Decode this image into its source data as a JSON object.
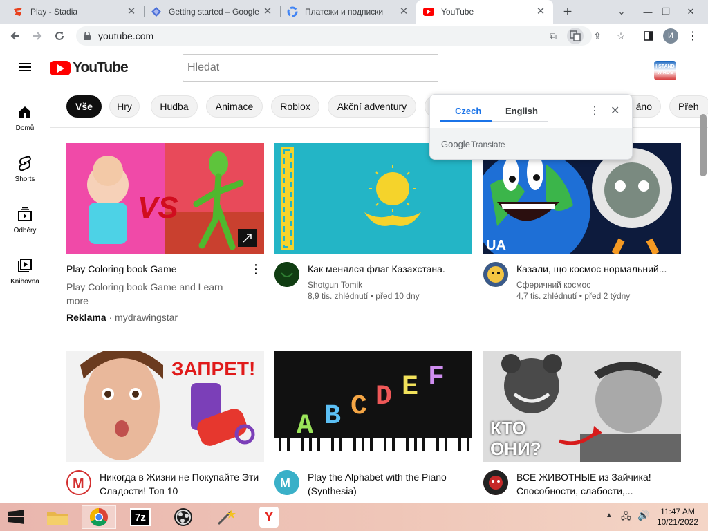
{
  "browser": {
    "tabs": [
      {
        "title": "Play - Stadia",
        "icon": "stadia-icon"
      },
      {
        "title": "Getting started – Google",
        "icon": "gcp-icon"
      },
      {
        "title": "Платежи и подписки",
        "icon": "google-icon"
      },
      {
        "title": "YouTube",
        "icon": "youtube-icon",
        "active": true
      }
    ],
    "url": "youtube.com",
    "profile_initial": "И"
  },
  "youtube": {
    "logo": "YouTube",
    "search_placeholder": "Hledat",
    "badge": "I STAND W RUS",
    "sidebar": [
      {
        "label": "Domů",
        "icon": "home-icon"
      },
      {
        "label": "Shorts",
        "icon": "shorts-icon"
      },
      {
        "label": "Odběry",
        "icon": "subscriptions-icon"
      },
      {
        "label": "Knihovna",
        "icon": "library-icon"
      }
    ],
    "chips": [
      "Vše",
      "Hry",
      "Hudba",
      "Animace",
      "Roblox",
      "Akční adventury",
      "",
      "",
      "áno",
      "Přeh"
    ],
    "videos": [
      {
        "title": "Play Coloring book Game",
        "desc": "Play Coloring book Game and Learn more",
        "ad_label": "Reklama",
        "ad_channel": "· mydrawingstar"
      },
      {
        "title": "Как менялся флаг Казахстана.",
        "channel": "Shotgun Tomik",
        "views": "8,9 tis. zhlédnutí",
        "age": "před 10 dny"
      },
      {
        "title": "Казали, що космос нормальний...",
        "channel": "Сферичний космос",
        "views": "4,7 tis. zhlédnutí",
        "age": "před 2 týdny"
      },
      {
        "title": "Никогда в Жизни не Покупайте Эти Сладости! Топ 10",
        "thumb_text": "ЗАПРЕТ!"
      },
      {
        "title": "Play the Alphabet with the Piano (Synthesia)"
      },
      {
        "title": "ВСЕ ЖИВОТНЫЕ из Зайчика! Способности, слабости,...",
        "thumb_text": "КТО ОНИ?"
      }
    ]
  },
  "translate": {
    "tab_source": "Czech",
    "tab_target": "English",
    "brand_google": "Google",
    "brand_translate": "Translate"
  },
  "taskbar": {
    "time": "11:47 AM",
    "date": "10/21/2022"
  },
  "colors": {
    "yt_red": "#ff0000",
    "chrome_tabbar": "#dee1e6",
    "translate_accent": "#1a73e8"
  }
}
